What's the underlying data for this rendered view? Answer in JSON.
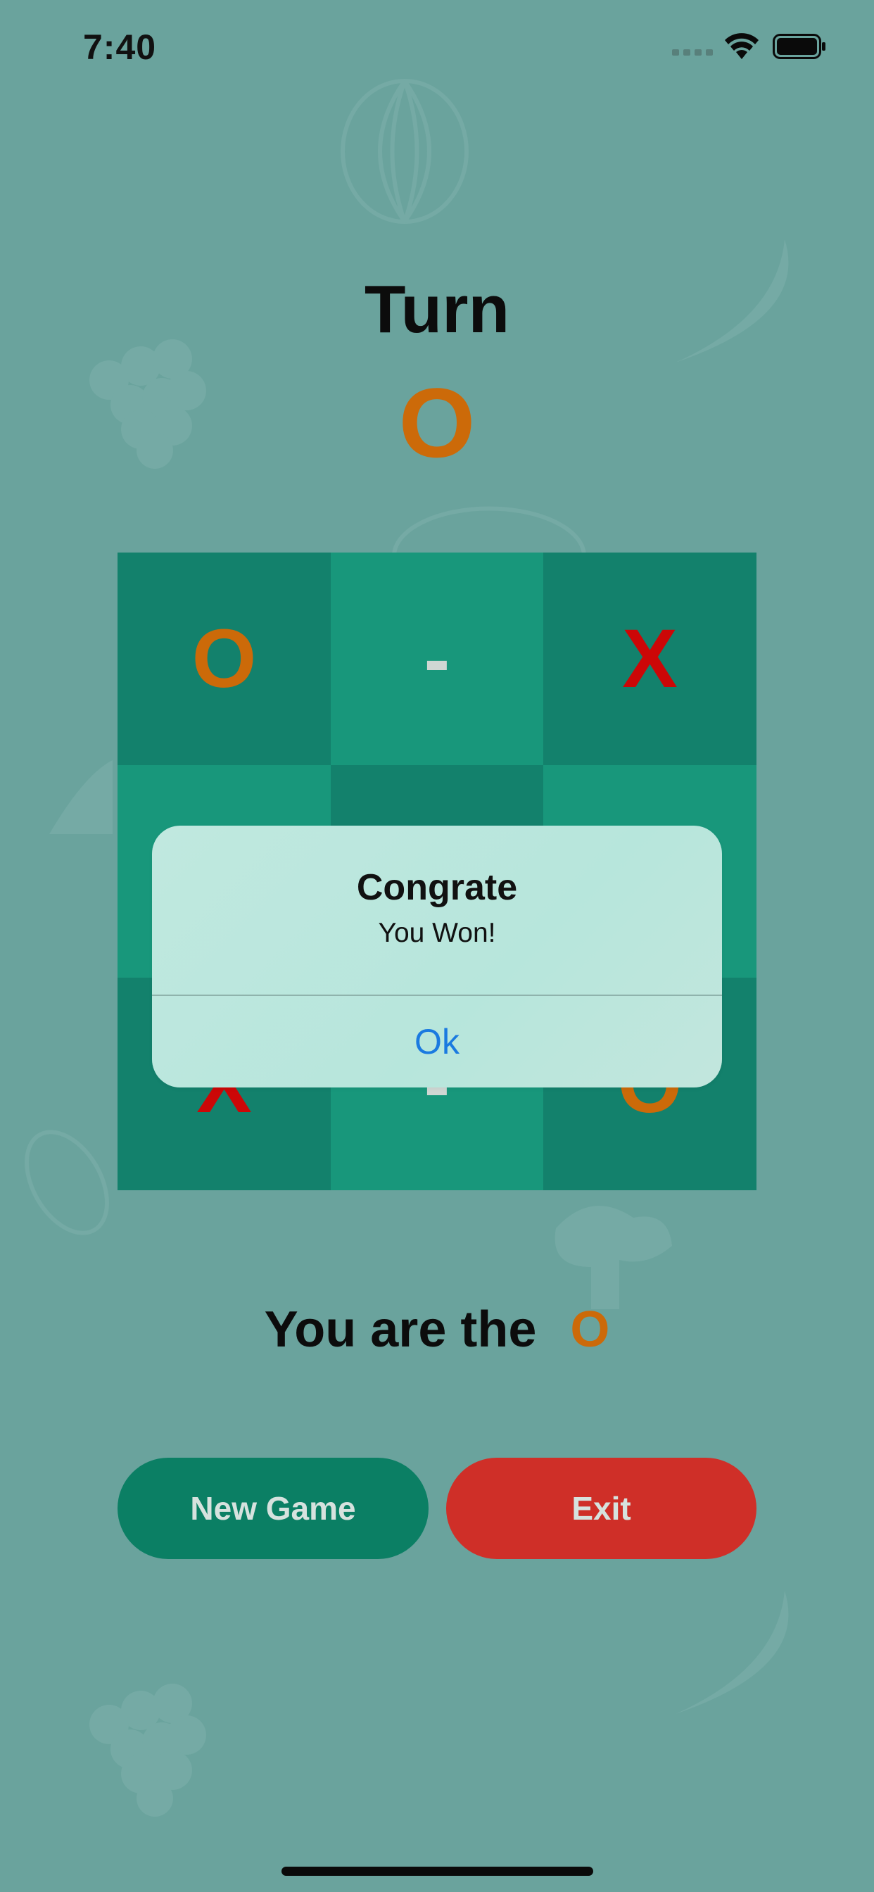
{
  "status_bar": {
    "time": "7:40"
  },
  "turn": {
    "title": "Turn",
    "current_player": "O"
  },
  "board": {
    "cells": [
      "O",
      "-",
      "X",
      "",
      "",
      "",
      "X",
      "-",
      "O"
    ]
  },
  "alert": {
    "title": "Congrate",
    "message": "You Won!",
    "ok_label": "Ok"
  },
  "player_info": {
    "label": "You are the",
    "player": "O"
  },
  "buttons": {
    "new_game": "New Game",
    "exit": "Exit"
  },
  "colors": {
    "background": "#6aa39d",
    "o_mark": "#cc6a09",
    "x_mark": "#cc0707",
    "new_game": "#0b7f64",
    "exit": "#cf2f28",
    "link": "#1a7ae0"
  },
  "icons": [
    "wifi-icon",
    "battery-icon",
    "signal-icon"
  ]
}
